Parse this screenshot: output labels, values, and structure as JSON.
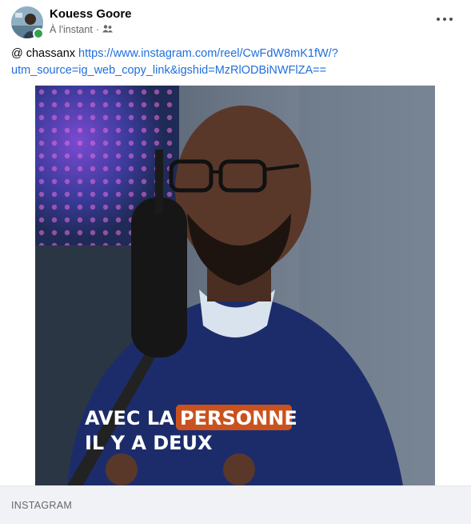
{
  "post": {
    "author": "Kouess Goore",
    "timestamp": "À l'instant",
    "audience_icon": "friends-icon",
    "more_icon": "more-horizontal-icon",
    "mention": "@ chassanx",
    "link_line1": "https://www.instagram.com/reel/CwFdW8mK1fW/?",
    "link_line2": "utm_source=ig_web_copy_link&igshid=MzRlODBiNWFlZA==",
    "video_overlay": {
      "line1_a": "AVEC LA",
      "line1_b": "PERSONNE",
      "line2": "IL Y A DEUX",
      "highlight_color": "#c9521f"
    },
    "source_label": "INSTAGRAM"
  },
  "colors": {
    "link": "#216fdb",
    "online": "#31a24c",
    "caption_bg": "#f0f2f5"
  }
}
